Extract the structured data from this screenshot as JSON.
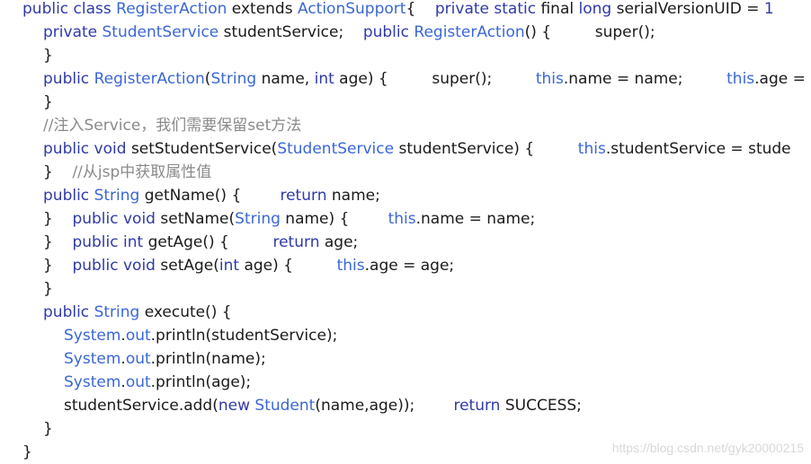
{
  "colors": {
    "keyword": "#2f3aa8",
    "type": "#3a67d6",
    "comment": "#8a8a8a",
    "plain": "#1a1a1a",
    "watermark": "#d8d8d8",
    "background": "#ffffff"
  },
  "lines": [
    {
      "indent": 0,
      "tokens": [
        {
          "c": "kw",
          "t": "public class "
        },
        {
          "c": "ty",
          "t": "RegisterAction"
        },
        {
          "c": "pl",
          "t": " extends "
        },
        {
          "c": "ty",
          "t": "ActionSupport"
        },
        {
          "c": "pl",
          "t": "{    "
        },
        {
          "c": "kw",
          "t": "private static "
        },
        {
          "c": "pl",
          "t": "final "
        },
        {
          "c": "kw",
          "t": "long"
        },
        {
          "c": "pl",
          "t": " serialVersionUID = "
        },
        {
          "c": "kw",
          "t": "1"
        }
      ]
    },
    {
      "indent": 1,
      "tokens": [
        {
          "c": "kw",
          "t": "private "
        },
        {
          "c": "ty",
          "t": "StudentService"
        },
        {
          "c": "pl",
          "t": " studentService;    "
        },
        {
          "c": "kw",
          "t": "public "
        },
        {
          "c": "ty",
          "t": "RegisterAction"
        },
        {
          "c": "pl",
          "t": "() {         super();"
        }
      ]
    },
    {
      "indent": 1,
      "tokens": [
        {
          "c": "pl",
          "t": "}"
        }
      ]
    },
    {
      "indent": 1,
      "tokens": [
        {
          "c": "kw",
          "t": "public "
        },
        {
          "c": "ty",
          "t": "RegisterAction"
        },
        {
          "c": "pl",
          "t": "("
        },
        {
          "c": "ty",
          "t": "String"
        },
        {
          "c": "pl",
          "t": " name, "
        },
        {
          "c": "kw",
          "t": "int"
        },
        {
          "c": "pl",
          "t": " age) {         super();         "
        },
        {
          "c": "ty",
          "t": "this"
        },
        {
          "c": "pl",
          "t": ".name = name;         "
        },
        {
          "c": "ty",
          "t": "this"
        },
        {
          "c": "pl",
          "t": ".age ="
        }
      ]
    },
    {
      "indent": 1,
      "tokens": [
        {
          "c": "pl",
          "t": "}"
        }
      ]
    },
    {
      "indent": 1,
      "tokens": [
        {
          "c": "cm",
          "t": "//注入Service，我们需要保留set方法"
        }
      ]
    },
    {
      "indent": 1,
      "tokens": [
        {
          "c": "kw",
          "t": "public void "
        },
        {
          "c": "pl",
          "t": "setStudentService("
        },
        {
          "c": "ty",
          "t": "StudentService"
        },
        {
          "c": "pl",
          "t": " studentService) {         "
        },
        {
          "c": "ty",
          "t": "this"
        },
        {
          "c": "pl",
          "t": ".studentService = stude"
        }
      ]
    },
    {
      "indent": 1,
      "tokens": [
        {
          "c": "pl",
          "t": "}    "
        },
        {
          "c": "cm",
          "t": "//从jsp中获取属性值"
        }
      ]
    },
    {
      "indent": 1,
      "tokens": [
        {
          "c": "kw",
          "t": "public "
        },
        {
          "c": "ty",
          "t": "String"
        },
        {
          "c": "pl",
          "t": " getName() {        "
        },
        {
          "c": "kw",
          "t": "return"
        },
        {
          "c": "pl",
          "t": " name;"
        }
      ]
    },
    {
      "indent": 1,
      "tokens": [
        {
          "c": "pl",
          "t": "}    "
        },
        {
          "c": "kw",
          "t": "public void "
        },
        {
          "c": "pl",
          "t": "setName("
        },
        {
          "c": "ty",
          "t": "String"
        },
        {
          "c": "pl",
          "t": " name) {        "
        },
        {
          "c": "ty",
          "t": "this"
        },
        {
          "c": "pl",
          "t": ".name = name;"
        }
      ]
    },
    {
      "indent": 1,
      "tokens": [
        {
          "c": "pl",
          "t": "}    "
        },
        {
          "c": "kw",
          "t": "public int "
        },
        {
          "c": "pl",
          "t": "getAge() {         "
        },
        {
          "c": "kw",
          "t": "return"
        },
        {
          "c": "pl",
          "t": " age;"
        }
      ]
    },
    {
      "indent": 1,
      "tokens": [
        {
          "c": "pl",
          "t": "}    "
        },
        {
          "c": "kw",
          "t": "public void "
        },
        {
          "c": "pl",
          "t": "setAge("
        },
        {
          "c": "kw",
          "t": "int"
        },
        {
          "c": "pl",
          "t": " age) {         "
        },
        {
          "c": "ty",
          "t": "this"
        },
        {
          "c": "pl",
          "t": ".age = age;"
        }
      ]
    },
    {
      "indent": 1,
      "tokens": [
        {
          "c": "pl",
          "t": "}"
        }
      ]
    },
    {
      "indent": 1,
      "tokens": [
        {
          "c": "kw",
          "t": "public "
        },
        {
          "c": "ty",
          "t": "String"
        },
        {
          "c": "pl",
          "t": " execute() {"
        }
      ]
    },
    {
      "indent": 2,
      "tokens": [
        {
          "c": "ty",
          "t": "System"
        },
        {
          "c": "pl",
          "t": "."
        },
        {
          "c": "ty",
          "t": "out"
        },
        {
          "c": "pl",
          "t": ".println(studentService);"
        }
      ]
    },
    {
      "indent": 2,
      "tokens": [
        {
          "c": "ty",
          "t": "System"
        },
        {
          "c": "pl",
          "t": "."
        },
        {
          "c": "ty",
          "t": "out"
        },
        {
          "c": "pl",
          "t": ".println(name);"
        }
      ]
    },
    {
      "indent": 2,
      "tokens": [
        {
          "c": "ty",
          "t": "System"
        },
        {
          "c": "pl",
          "t": "."
        },
        {
          "c": "ty",
          "t": "out"
        },
        {
          "c": "pl",
          "t": ".println(age);"
        }
      ]
    },
    {
      "indent": 2,
      "tokens": [
        {
          "c": "pl",
          "t": "studentService.add("
        },
        {
          "c": "kw",
          "t": "new "
        },
        {
          "c": "ty",
          "t": "Student"
        },
        {
          "c": "pl",
          "t": "(name,age));        "
        },
        {
          "c": "kw",
          "t": "return"
        },
        {
          "c": "pl",
          "t": " SUCCESS;"
        }
      ]
    },
    {
      "indent": 1,
      "tokens": [
        {
          "c": "pl",
          "t": "}"
        }
      ]
    },
    {
      "indent": 0,
      "tokens": [
        {
          "c": "pl",
          "t": "}"
        }
      ]
    }
  ],
  "watermark": "https://blog.csdn.net/gyk20000215"
}
